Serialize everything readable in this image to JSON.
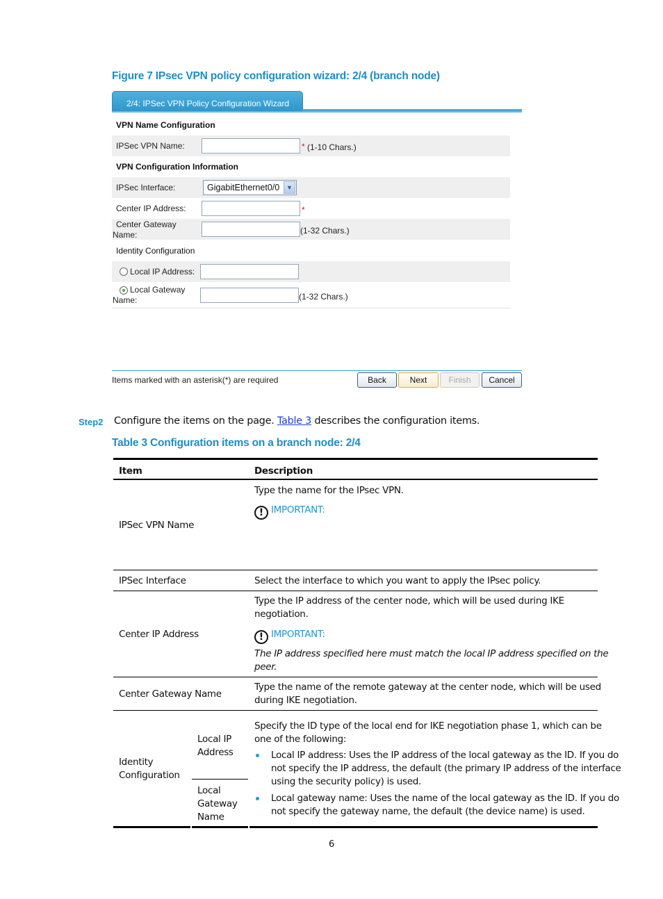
{
  "figure_caption": "Figure 7 IPsec VPN policy configuration wizard: 2/4 (branch node)",
  "wizard": {
    "tab_title": "2/4: IPSec VPN Policy Configuration Wizard",
    "sections": {
      "vpn_name": "VPN Name Configuration",
      "vpn_config": "VPN Configuration Information",
      "identity": "Identity Configuration"
    },
    "fields": {
      "ipsec_vpn_name": {
        "label": "IPSec VPN Name:",
        "value": "",
        "required_mark": "*",
        "hint": "(1-10 Chars.)"
      },
      "ipsec_interface": {
        "label": "IPSec Interface:",
        "selected": "GigabitEthernet0/0"
      },
      "center_ip": {
        "label": "Center IP Address:",
        "value": "",
        "required_mark": "*"
      },
      "center_gateway": {
        "label_line1": "Center Gateway",
        "label_line2": "Name:",
        "value": "",
        "hint": "(1-32 Chars.)"
      },
      "local_ip": {
        "label": "Local IP Address:",
        "value": "",
        "checked": false
      },
      "local_gateway": {
        "label_line1": "Local Gateway",
        "label_line2": "Name:",
        "value": "",
        "hint": "(1-32 Chars.)",
        "checked": true
      }
    },
    "footer_note": "Items marked with an asterisk(*) are required",
    "buttons": {
      "back": "Back",
      "next": "Next",
      "finish": "Finish",
      "cancel": "Cancel"
    }
  },
  "step": {
    "label": "Step2",
    "text_before": "Configure the items on the page. ",
    "link": "Table 3",
    "text_after": " describes the configuration items."
  },
  "table_caption": "Table 3 Configuration items on a branch node: 2/4",
  "table": {
    "headers": {
      "item": "Item",
      "description": "Description"
    },
    "important_label": "IMPORTANT:",
    "rows": {
      "vpn_name": {
        "item": "IPSec VPN Name",
        "desc": "Type the name for the IPsec VPN."
      },
      "interface": {
        "item": "IPSec Interface",
        "desc": "Select the interface to which you want to apply the IPsec policy."
      },
      "center_ip": {
        "item": "Center IP Address",
        "desc_line1": "Type the IP address of the center node, which will be used during IKE",
        "desc_line2": "negotiation.",
        "note_line1": "The IP address specified here must match the local IP address specified on the",
        "note_line2": "peer."
      },
      "center_gateway": {
        "item": "Center Gateway Name",
        "desc_line1": "Type the name of the remote gateway at the center node, which will be used",
        "desc_line2": "during IKE negotiation."
      },
      "identity": {
        "item_line1": "Identity",
        "item_line2": "Configuration",
        "sub1_line1": "Local IP",
        "sub1_line2": "Address",
        "sub2_line1": "Local",
        "sub2_line2": "Gateway",
        "sub2_line3": "Name",
        "intro_line1": "Specify the ID type of the local end for IKE negotiation phase 1, which can be",
        "intro_line2": "one of the following:",
        "bullet1_line1": "Local IP address: Uses the IP address of the local gateway as the ID. If you do",
        "bullet1_line2": "not specify the IP address, the default (the primary IP address of the interface",
        "bullet1_line3": "using the security policy) is used.",
        "bullet2_line1": "Local gateway name: Uses the name of the local gateway as the ID. If you do",
        "bullet2_line2": "not specify the gateway name, the default (the device name) is used."
      }
    }
  },
  "page_number": "6"
}
